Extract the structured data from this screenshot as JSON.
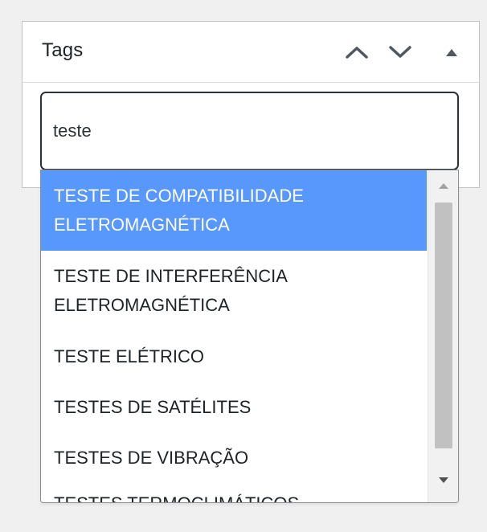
{
  "panel": {
    "title": "Tags",
    "controls": {
      "move_up_icon": "chevron-up-icon",
      "move_down_icon": "chevron-down-icon",
      "toggle_icon": "caret-up-icon"
    }
  },
  "tag_input": {
    "value": "teste"
  },
  "dropdown": {
    "items": [
      {
        "line1": "TESTE DE COMPATIBILIDADE",
        "line2": "ELETROMAGNÉTICA",
        "highlighted": true
      },
      {
        "line1": "TESTE DE INTERFERÊNCIA",
        "line2": "ELETROMAGNÉTICA",
        "highlighted": false
      },
      {
        "line1": "TESTE ELÉTRICO"
      },
      {
        "line1": "TESTES DE SATÉLITES"
      },
      {
        "line1": "TESTES DE VIBRAÇÃO"
      },
      {
        "line1": "TESTES TERMOCLIMÁTICOS"
      }
    ]
  },
  "colors": {
    "highlight": "#5897fb",
    "background": "#f0f0f1",
    "text": "#1d2327"
  }
}
